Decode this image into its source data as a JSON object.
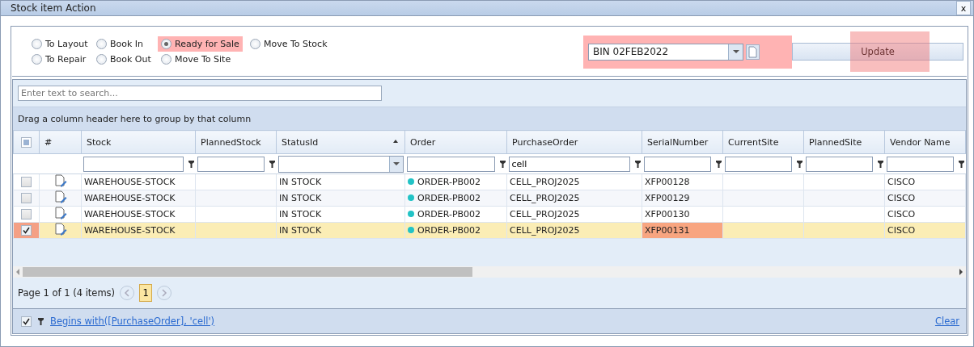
{
  "window": {
    "title": "Stock item Action",
    "close": "x"
  },
  "actions": [
    {
      "label": "To Layout",
      "selected": false,
      "highlighted": false
    },
    {
      "label": "Book In",
      "selected": false,
      "highlighted": false
    },
    {
      "label": "Ready for Sale",
      "selected": true,
      "highlighted": true
    },
    {
      "label": "Move To Stock",
      "selected": false,
      "highlighted": false
    },
    {
      "label": "To Repair",
      "selected": false,
      "highlighted": false
    },
    {
      "label": "Book Out",
      "selected": false,
      "highlighted": false
    },
    {
      "label": "Move To Site",
      "selected": false,
      "highlighted": false
    }
  ],
  "bin": {
    "value": "BIN 02FEB2022",
    "highlighted": true
  },
  "update_button": {
    "label": "Update",
    "highlighted": true
  },
  "grid": {
    "search_placeholder": "Enter text to search...",
    "group_hint": "Drag a column header here to group by that column",
    "select_all_checked": false,
    "number_header": "#",
    "columns": [
      {
        "label": "Stock",
        "kind": "text",
        "sorted": false
      },
      {
        "label": "PlannedStock",
        "kind": "text",
        "sorted": false
      },
      {
        "label": "StatusId",
        "kind": "dropdown",
        "sorted": true
      },
      {
        "label": "Order",
        "kind": "text",
        "sorted": false
      },
      {
        "label": "PurchaseOrder",
        "kind": "text",
        "sorted": false,
        "filter": "cell"
      },
      {
        "label": "SerialNumber",
        "kind": "text",
        "sorted": false
      },
      {
        "label": "CurrentSite",
        "kind": "text",
        "sorted": false
      },
      {
        "label": "PlannedSite",
        "kind": "text",
        "sorted": false
      },
      {
        "label": "Vendor Name",
        "kind": "text",
        "sorted": false
      }
    ],
    "rows": [
      {
        "selected": false,
        "highlighted": false,
        "cells": [
          "WAREHOUSE-STOCK",
          null,
          "IN STOCK",
          "ORDER-PB002",
          "CELL_PROJ2025",
          "XFP00128",
          null,
          null,
          "CISCO"
        ]
      },
      {
        "selected": false,
        "highlighted": false,
        "cells": [
          "WAREHOUSE-STOCK",
          null,
          "IN STOCK",
          "ORDER-PB002",
          "CELL_PROJ2025",
          "XFP00129",
          null,
          null,
          "CISCO"
        ]
      },
      {
        "selected": false,
        "highlighted": false,
        "cells": [
          "WAREHOUSE-STOCK",
          null,
          "IN STOCK",
          "ORDER-PB002",
          "CELL_PROJ2025",
          "XFP00130",
          null,
          null,
          "CISCO"
        ]
      },
      {
        "selected": true,
        "highlighted": true,
        "cells": [
          "WAREHOUSE-STOCK",
          null,
          "IN STOCK",
          "ORDER-PB002",
          "CELL_PROJ2025",
          "XFP00131",
          null,
          null,
          "CISCO"
        ]
      }
    ],
    "pager": {
      "summary": "Page 1 of 1 (4 items)",
      "pages": [
        {
          "label": "1",
          "selected": true
        }
      ]
    },
    "filter_bar": {
      "enabled": true,
      "expression": "Begins with([PurchaseOrder], 'cell')",
      "clear": "Clear"
    }
  }
}
